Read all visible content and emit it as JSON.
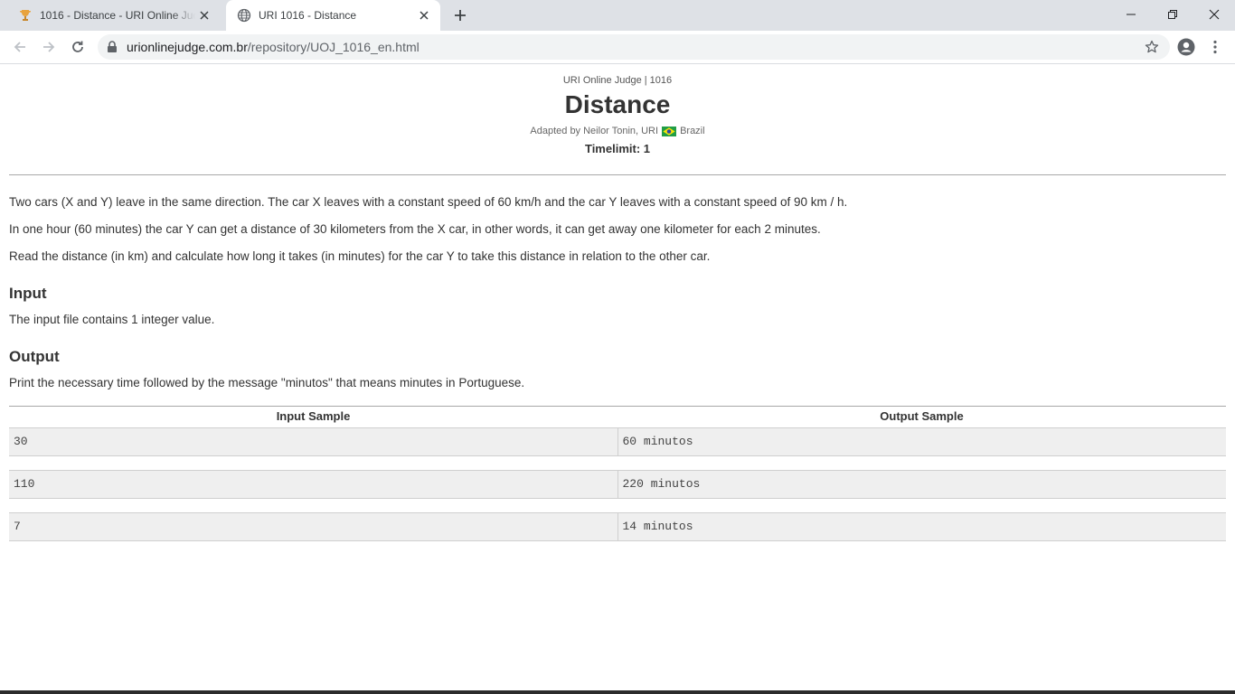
{
  "browser": {
    "tabs": [
      {
        "title": "1016 - Distance - URI Online Judge",
        "favicon": "trophy-icon",
        "active": false
      },
      {
        "title": "URI 1016 - Distance",
        "favicon": "globe-icon",
        "active": true
      }
    ],
    "url_host": "urionlinejudge.com.br",
    "url_path": "/repository/UOJ_1016_en.html"
  },
  "problem": {
    "breadcrumb": "URI Online Judge | 1016",
    "title": "Distance",
    "author_prefix": "Adapted by Neilor Tonin, URI",
    "author_country": "Brazil",
    "timelimit": "Timelimit: 1",
    "description": [
      "Two cars (X and Y) leave in the same direction. The car X leaves with a constant speed of 60 km/h and the car Y leaves with a constant speed of 90 km / h.",
      "In one hour (60 minutes) the car Y can get a distance of 30 kilometers from the X car, in other words, it can get away one kilometer for each 2 minutes.",
      "Read the distance (in km) and calculate how long it takes (in minutes) for the car Y to take this distance in relation to the other car."
    ],
    "input_heading": "Input",
    "input_text": "The input file contains 1 integer value.",
    "output_heading": "Output",
    "output_text": "Print the necessary time followed by the message \"minutos\" that means minutes in Portuguese."
  },
  "samples": {
    "input_header": "Input Sample",
    "output_header": "Output Sample",
    "rows": [
      {
        "input": "30",
        "output": "60 minutos"
      },
      {
        "input": "110",
        "output": "220 minutos"
      },
      {
        "input": "7",
        "output": "14 minutos"
      }
    ]
  }
}
